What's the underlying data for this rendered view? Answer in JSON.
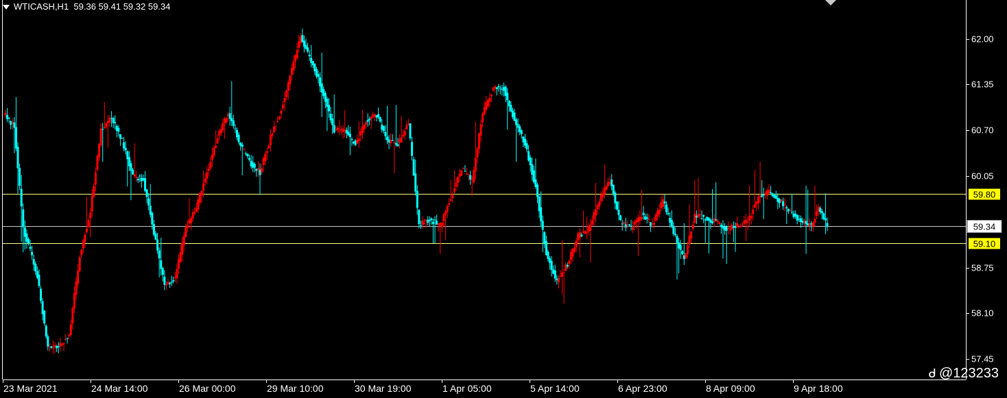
{
  "header": {
    "symbol": "WTICASH,H1",
    "ohlc": "59.36 59.41 59.32 59.34"
  },
  "watermark": "@123233",
  "colors": {
    "background": "#000000",
    "bull": "#ff0000",
    "bear": "#00ffff",
    "hline": "#ffff80",
    "price_line": "#c8c8c8"
  },
  "chart_data": {
    "type": "candlestick",
    "title": "WTICASH,H1",
    "y_ticks": [
      "62.00",
      "61.35",
      "60.70",
      "60.05",
      "58.75",
      "58.10",
      "57.45"
    ],
    "ylim": [
      57.16,
      62.55
    ],
    "x_ticks": [
      "23 Mar 2021",
      "24 Mar 14:00",
      "26 Mar 00:00",
      "29 Mar 10:00",
      "30 Mar 19:00",
      "1 Apr 05:00",
      "5 Apr 14:00",
      "6 Apr 23:00",
      "8 Apr 09:00",
      "9 Apr 18:00"
    ],
    "horizontal_lines": [
      {
        "value": 59.8,
        "label": "59.80"
      },
      {
        "value": 59.1,
        "label": "59.10"
      }
    ],
    "last_price": {
      "value": 59.34,
      "label": "59.34"
    },
    "anchors": [
      [
        0,
        60.91
      ],
      [
        5,
        60.75
      ],
      [
        10,
        59.3
      ],
      [
        14,
        58.98
      ],
      [
        18,
        58.63
      ],
      [
        24,
        57.6
      ],
      [
        30,
        57.63
      ],
      [
        36,
        57.8
      ],
      [
        42,
        58.9
      ],
      [
        48,
        59.55
      ],
      [
        54,
        60.7
      ],
      [
        60,
        60.9
      ],
      [
        66,
        60.55
      ],
      [
        72,
        60.05
      ],
      [
        78,
        60.0
      ],
      [
        84,
        59.25
      ],
      [
        90,
        58.5
      ],
      [
        96,
        58.6
      ],
      [
        102,
        59.3
      ],
      [
        108,
        59.6
      ],
      [
        114,
        60.1
      ],
      [
        120,
        60.6
      ],
      [
        126,
        60.95
      ],
      [
        132,
        60.55
      ],
      [
        138,
        60.25
      ],
      [
        144,
        60.1
      ],
      [
        150,
        60.6
      ],
      [
        156,
        61.0
      ],
      [
        162,
        61.55
      ],
      [
        167,
        62.05
      ],
      [
        171,
        61.8
      ],
      [
        176,
        61.5
      ],
      [
        180,
        61.2
      ],
      [
        186,
        60.7
      ],
      [
        192,
        60.7
      ],
      [
        198,
        60.5
      ],
      [
        204,
        60.85
      ],
      [
        210,
        60.92
      ],
      [
        216,
        60.55
      ],
      [
        222,
        60.5
      ],
      [
        228,
        60.8
      ],
      [
        234,
        59.35
      ],
      [
        240,
        59.43
      ],
      [
        246,
        59.35
      ],
      [
        252,
        59.75
      ],
      [
        258,
        60.15
      ],
      [
        264,
        59.98
      ],
      [
        270,
        60.95
      ],
      [
        276,
        61.3
      ],
      [
        282,
        61.3
      ],
      [
        288,
        60.85
      ],
      [
        294,
        60.5
      ],
      [
        300,
        59.9
      ],
      [
        306,
        58.95
      ],
      [
        312,
        58.55
      ],
      [
        318,
        58.8
      ],
      [
        324,
        59.2
      ],
      [
        330,
        59.3
      ],
      [
        336,
        59.7
      ],
      [
        342,
        60.0
      ],
      [
        348,
        59.4
      ],
      [
        354,
        59.3
      ],
      [
        360,
        59.5
      ],
      [
        366,
        59.35
      ],
      [
        372,
        59.7
      ],
      [
        378,
        59.25
      ],
      [
        384,
        58.85
      ],
      [
        390,
        59.5
      ],
      [
        396,
        59.45
      ],
      [
        402,
        59.4
      ],
      [
        408,
        59.3
      ],
      [
        414,
        59.35
      ],
      [
        420,
        59.4
      ],
      [
        426,
        59.75
      ],
      [
        432,
        59.82
      ],
      [
        438,
        59.7
      ],
      [
        444,
        59.55
      ],
      [
        450,
        59.4
      ],
      [
        456,
        59.35
      ],
      [
        460,
        59.6
      ],
      [
        465,
        59.34
      ]
    ]
  }
}
